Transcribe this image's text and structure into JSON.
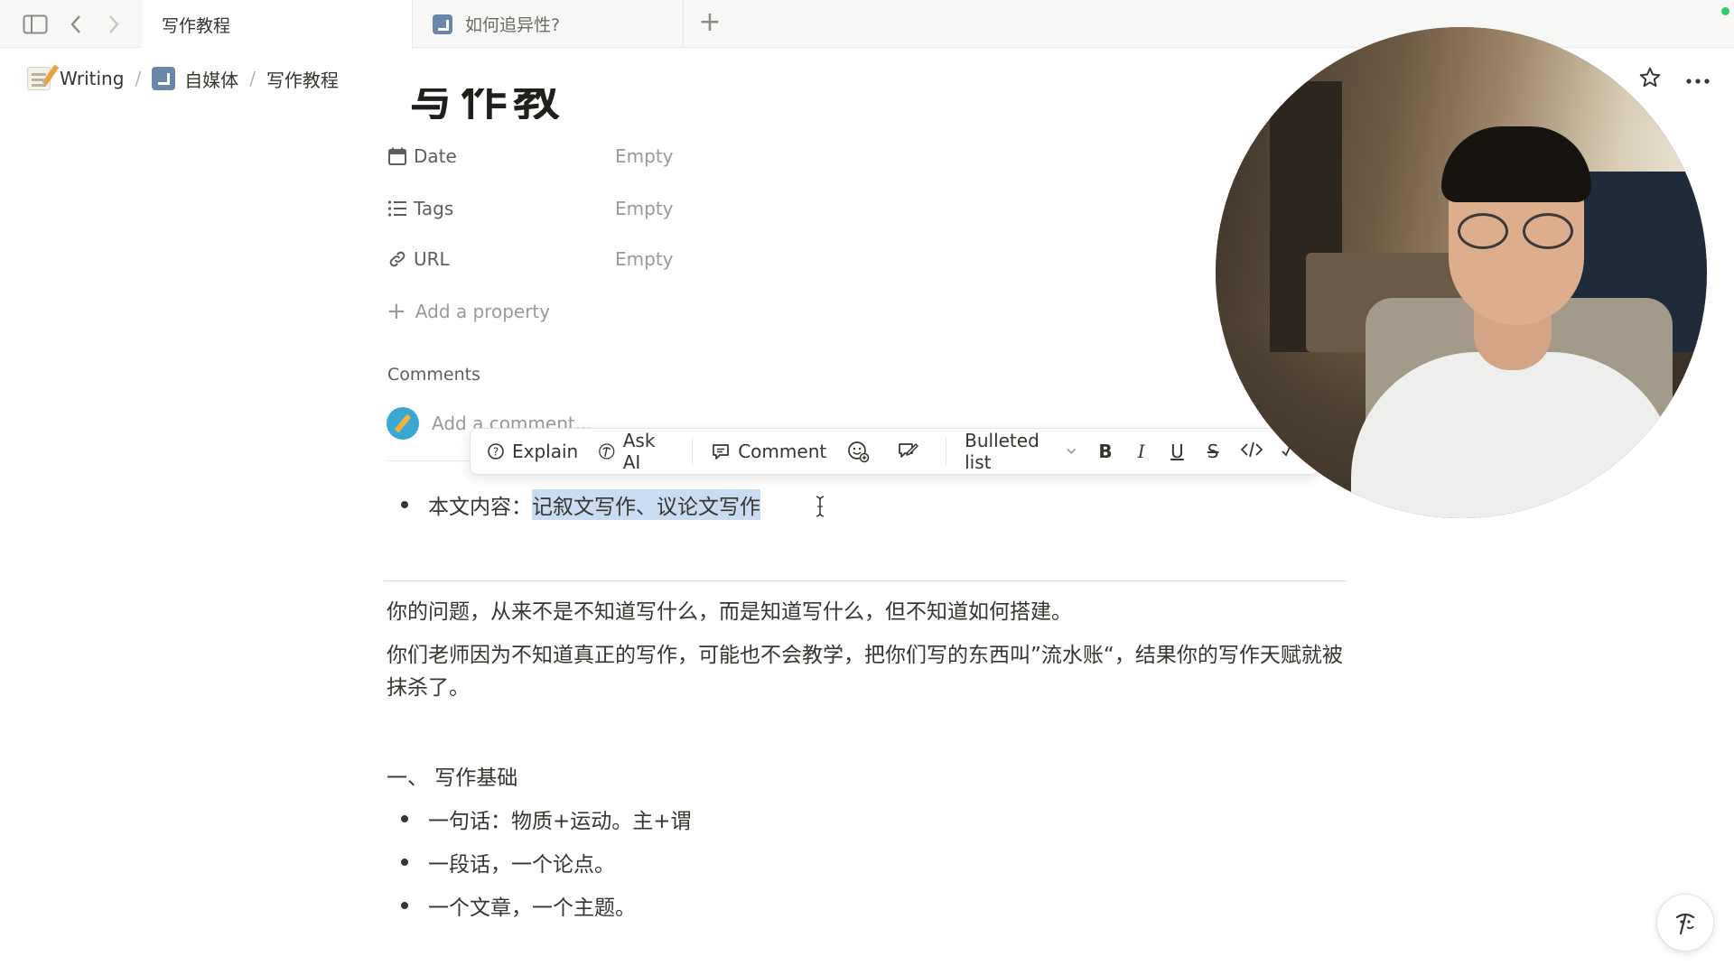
{
  "tabs": [
    {
      "label": "写作教程",
      "active": true
    },
    {
      "label": "如何追异性?",
      "active": false
    }
  ],
  "breadcrumb": [
    {
      "label": "Writing",
      "icon": "memo-icon"
    },
    {
      "label": "自媒体",
      "icon": "arrow-box-icon"
    },
    {
      "label": "写作教程"
    }
  ],
  "page": {
    "title": "写作教程"
  },
  "properties": [
    {
      "name": "Date",
      "value": "Empty",
      "icon": "calendar-icon"
    },
    {
      "name": "Tags",
      "value": "Empty",
      "icon": "list-icon"
    },
    {
      "name": "URL",
      "value": "Empty",
      "icon": "link-icon"
    }
  ],
  "add_property": "Add a property",
  "comments": {
    "heading": "Comments",
    "placeholder": "Add a comment..."
  },
  "toolbar": {
    "explain": "Explain",
    "ask_ai": "Ask AI",
    "comment": "Comment",
    "block_type": "Bulleted list",
    "bold": "B",
    "italic": "I",
    "underline": "U",
    "strike": "S"
  },
  "content": {
    "summary_prefix": "本文内容：",
    "summary_highlight": "记叙文写作、议论文写作",
    "para1": "你的问题，从来不是不知道写什么，而是知道写什么，但不知道如何搭建。",
    "para2": "你们老师因为不知道真正的写作，可能也不会教学，把你们写的东西叫”流水账“，结果你的写作天赋就被抹杀了。",
    "section1": "一、 写作基础",
    "bullets": [
      "一句话：物质+运动。主+谓",
      "一段话，一个论点。",
      "一个文章，一个主题。"
    ]
  },
  "colors": {
    "selection": "#c9dcf2",
    "text": "#37352f",
    "muted": "#9b9a97",
    "status": "#2ecc71"
  }
}
